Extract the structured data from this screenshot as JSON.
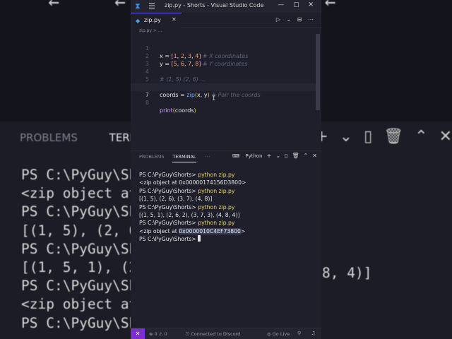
{
  "background": {
    "top_code": "     ←     ←            ←     ←",
    "panel_tabs": [
      "PROBLEMS",
      "TERMINAL"
    ],
    "panel_icons": [
      "+",
      "⌄",
      "▯",
      "🗑",
      "⌃",
      "✕"
    ],
    "lines": [
      "PS C:\\PyGuy\\Sh",
      "<zip object at",
      "PS C:\\PyGuy\\Sh",
      "[(1, 5), (2, 6",
      "PS C:\\PyGuy\\Sh",
      "[(1, 5, 1), (2",
      "PS C:\\PyGuy\\Sh",
      "<zip object at",
      "PS C:\\PyGuy\\Sh"
    ],
    "right_fragment": "8, 4)]"
  },
  "window": {
    "title": "zip.py - Shorts - Visual Studio Code",
    "controls": "—  ▢  ✕"
  },
  "tab": {
    "filename": "zip.py",
    "close": "✕",
    "actions": "▷ ⌄  ⊟  ⋯"
  },
  "breadcrumb": "zip.py > ...",
  "editor": {
    "lines": [
      {
        "n": "1"
      },
      {
        "n": "2"
      },
      {
        "n": "3"
      },
      {
        "n": "4"
      },
      {
        "n": "5"
      },
      {
        "n": "6"
      },
      {
        "n": "7"
      },
      {
        "n": "8"
      }
    ],
    "code": {
      "l1_var": "x",
      "l1_vals": [
        "1",
        "2",
        "3",
        "4"
      ],
      "l1_comment": "# X coordinates",
      "l2_var": "y",
      "l2_vals": [
        "5",
        "6",
        "7",
        "8"
      ],
      "l2_comment": "# Y coordinates",
      "l4_comment": "# (1, 5) (2, 6) ...",
      "l6_var": "coords",
      "l6_fn": "zip",
      "l6_args": "x, y",
      "l6_comment": "# Pair the coords",
      "l8_fn": "print",
      "l8_arg": "coords"
    }
  },
  "panel": {
    "tabs": {
      "problems": "PROBLEMS",
      "terminal": "TERMINAL",
      "more": "···"
    },
    "shell": "Python",
    "icons": {
      "add": "+",
      "dropdown": "⌄",
      "split": "▯",
      "trash": "🗑",
      "maximize": "⌃",
      "close": "✕"
    },
    "terminal": [
      {
        "prompt": "PS C:\\PyGuy\\Shorts>",
        "cmd": "python zip.py"
      },
      {
        "out": "<zip object at 0x00000174156D3800>"
      },
      {
        "prompt": "PS C:\\PyGuy\\Shorts>",
        "cmd": "python zip.py"
      },
      {
        "out": "[(1, 5), (2, 6), (3, 7), (4, 8)]"
      },
      {
        "prompt": "PS C:\\PyGuy\\Shorts>",
        "cmd": "python zip.py"
      },
      {
        "out": "[(1, 5, 1), (2, 6, 2), (3, 7, 3), (4, 8, 4)]"
      },
      {
        "prompt": "PS C:\\PyGuy\\Shorts>",
        "cmd": "python zip.py"
      },
      {
        "out_pre": "<zip object at ",
        "out_hl": "0x0000010C4EF73800",
        "out_post": ">"
      },
      {
        "prompt": "PS C:\\PyGuy\\Shorts>"
      }
    ]
  },
  "statusbar": {
    "remote_icon": "✕",
    "errors": "⊗ 0  ⚠ 0",
    "live_share": "Connected to Discord",
    "go_live": "Go Live",
    "right_icons": "⚲ ♫"
  },
  "colors": {
    "accent": "#7b2fd1",
    "string_yellow": "#e8d66e",
    "number_orange": "#f39c6b",
    "function_blue": "#7aa6ff"
  }
}
